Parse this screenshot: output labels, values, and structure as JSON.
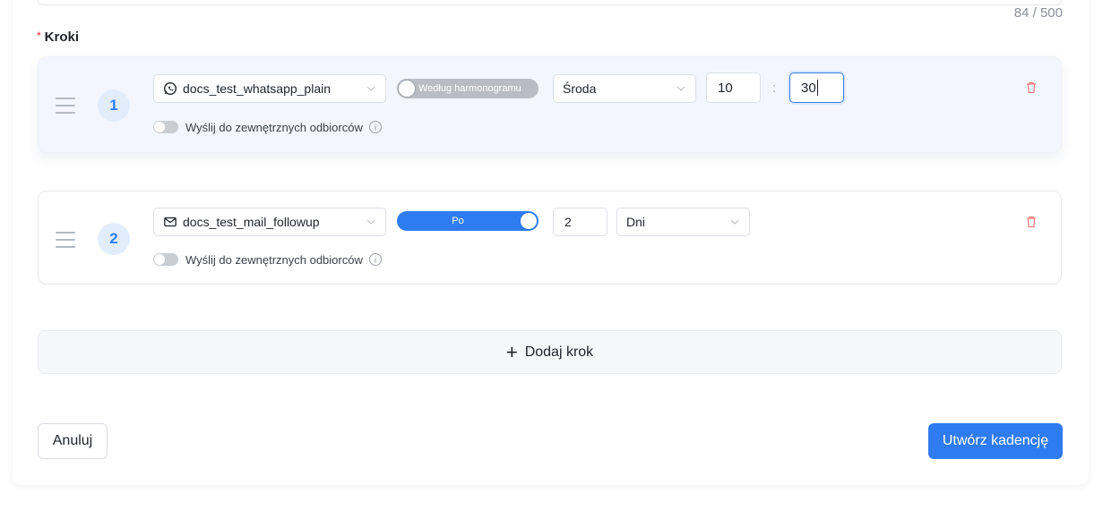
{
  "description_field": {
    "counter": "84 / 500"
  },
  "steps_section": {
    "label": "Kroki",
    "required_mark": "*"
  },
  "steps": [
    {
      "number": "1",
      "template": "docs_test_whatsapp_plain",
      "template_icon": "whatsapp-icon",
      "timing_toggle_label": "Według harmonogramu",
      "timing_toggle_on": false,
      "day": "Środa",
      "hour": "10",
      "minute": "30",
      "time_separator": ":",
      "external_label": "Wyślij do zewnętrznych odbiorców"
    },
    {
      "number": "2",
      "template": "docs_test_mail_followup",
      "template_icon": "mail-icon",
      "timing_toggle_label": "Po",
      "timing_toggle_on": true,
      "delay_value": "2",
      "delay_unit": "Dni",
      "external_label": "Wyślij do zewnętrznych odbiorców"
    }
  ],
  "add_step_label": "Dodaj krok",
  "footer": {
    "cancel_label": "Anuluj",
    "submit_label": "Utwórz kadencję"
  },
  "colors": {
    "primary": "#2f7bf0",
    "danger": "#f5222d",
    "step_active_bg": "#f3f7fd"
  }
}
